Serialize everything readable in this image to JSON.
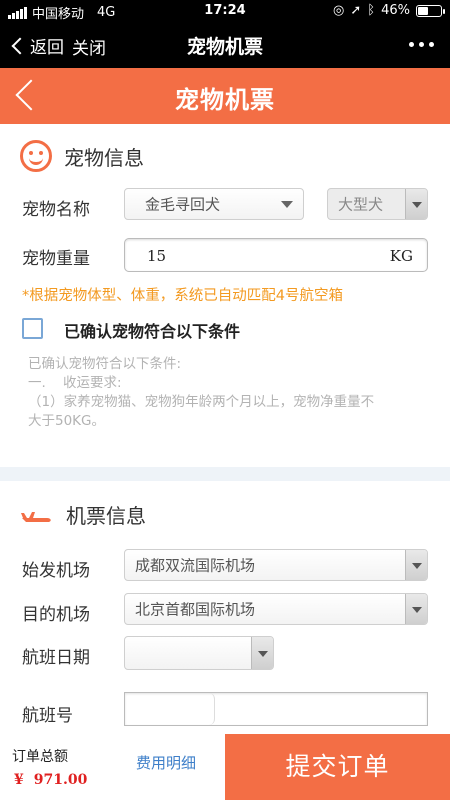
{
  "status_bar": {
    "carrier": "中国移动",
    "network": "4G",
    "time": "17:24",
    "battery": "46%",
    "battery_level": 0.46
  },
  "wechat_nav": {
    "back_label": "返回",
    "close_label": "关闭",
    "title": "宠物机票"
  },
  "header": {
    "title": "宠物机票"
  },
  "pet_section": {
    "title": "宠物信息",
    "name_label": "宠物名称",
    "breed_value": "金毛寻回犬",
    "size_value": "大型犬",
    "weight_label": "宠物重量",
    "weight_value": "15",
    "weight_unit": "KG",
    "hint": "*根据宠物体型、体重，系统已自动匹配4号航空箱",
    "confirm_label": "已确认宠物符合以下条件",
    "terms": [
      "已确认宠物符合以下条件:",
      "一.    收运要求:",
      "（1）家养宠物猫、宠物狗年龄两个月以上，宠物净重量不",
      "大于50KG。"
    ]
  },
  "ticket_section": {
    "title": "机票信息",
    "departure_label": "始发机场",
    "departure_value": "成都双流国际机场",
    "destination_label": "目的机场",
    "destination_value": "北京首都国际机场",
    "date_label": "航班日期",
    "date_value": "",
    "flight_label": "航班号",
    "flight_value": ""
  },
  "footer": {
    "total_label": "订单总额",
    "currency": "¥",
    "total_value": "971.00",
    "fee_detail": "费用明细",
    "submit": "提交订单"
  },
  "colors": {
    "accent": "#f36e45",
    "hint": "#f39a21",
    "link": "#3e7fc9",
    "price": "#e02020"
  }
}
